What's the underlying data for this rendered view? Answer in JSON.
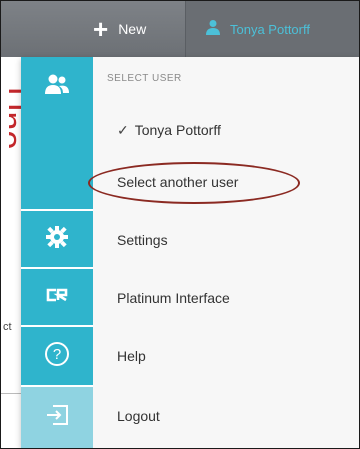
{
  "topbar": {
    "new_label": "New",
    "user_label": "Tonya Pottorff"
  },
  "dropdown": {
    "section_label": "SELECT USER",
    "items": [
      {
        "label": "Tonya Pottorff",
        "checked": true
      },
      {
        "label": "Select another user"
      },
      {
        "label": "Settings"
      },
      {
        "label": "Platinum Interface"
      },
      {
        "label": "Help"
      },
      {
        "label": "Logout"
      }
    ]
  },
  "background": {
    "red_text": "Uno",
    "ct_text": "ct"
  },
  "colors": {
    "topbar": "#767a7f",
    "rail": "#2fb4cc",
    "rail_light": "#8fd3e1",
    "user_accent": "#4cc0d8",
    "annotation_oval": "#8b2a22"
  },
  "icons": {
    "new": "plus-icon",
    "user": "user-icon",
    "users": "users-icon",
    "settings": "gear-icon",
    "platinum": "cr-logo-icon",
    "help": "help-circle-icon",
    "logout": "logout-icon"
  }
}
